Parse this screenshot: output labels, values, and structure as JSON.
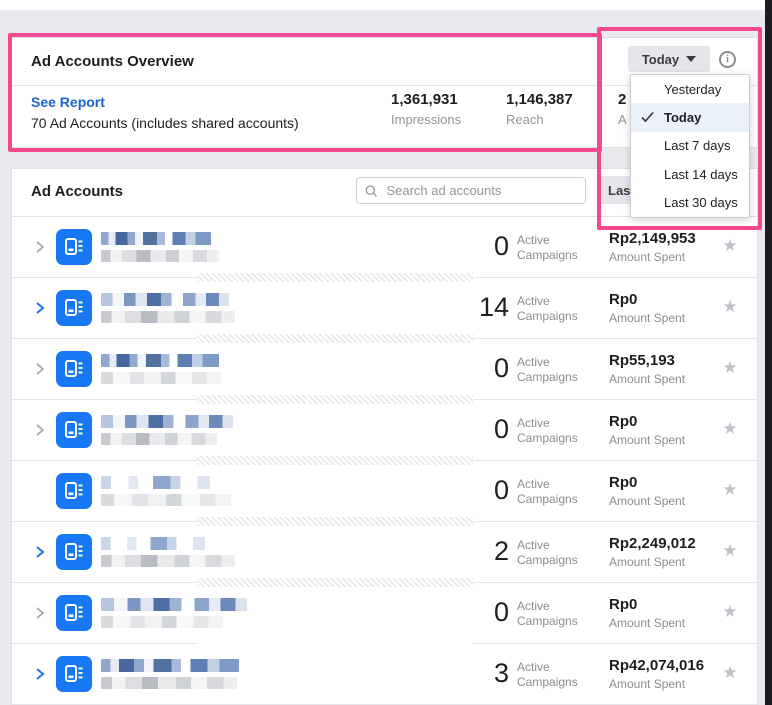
{
  "overview": {
    "title": "Ad Accounts Overview",
    "see_report": "See Report",
    "subtitle": "70 Ad Accounts (includes shared accounts)",
    "stats": [
      {
        "value": "1,361,931",
        "label": "Impressions"
      },
      {
        "value": "1,146,387",
        "label": "Reach"
      },
      {
        "value": "2",
        "label": "A"
      }
    ],
    "date_button_label": "Today",
    "dropdown": {
      "selected": "Today",
      "items": [
        "Yesterday",
        "Today",
        "Last 7 days",
        "Last 14 days",
        "Last 30 days"
      ]
    }
  },
  "accounts": {
    "title": "Ad Accounts",
    "search_placeholder": "Search ad accounts",
    "range_button_visible_label": "Last",
    "active_label_line1": "Active",
    "active_label_line2": "Campaigns",
    "amount_label": "Amount Spent",
    "rows": [
      {
        "active_campaigns": "0",
        "amount_spent": "Rp2,149,953"
      },
      {
        "active_campaigns": "14",
        "amount_spent": "Rp0"
      },
      {
        "active_campaigns": "0",
        "amount_spent": "Rp55,193"
      },
      {
        "active_campaigns": "0",
        "amount_spent": "Rp0"
      },
      {
        "active_campaigns": "0",
        "amount_spent": "Rp0"
      },
      {
        "active_campaigns": "2",
        "amount_spent": "Rp2,249,012"
      },
      {
        "active_campaigns": "0",
        "amount_spent": "Rp0"
      },
      {
        "active_campaigns": "3",
        "amount_spent": "Rp42,074,016"
      }
    ]
  },
  "icons": {
    "star": "★",
    "info": "i"
  },
  "colors": {
    "annotation_pink": "#F5478F",
    "facebook_blue": "#1877F2",
    "link_blue": "#1B66C9",
    "page_background": "#E9EAED",
    "muted_text": "#8A8D91"
  }
}
